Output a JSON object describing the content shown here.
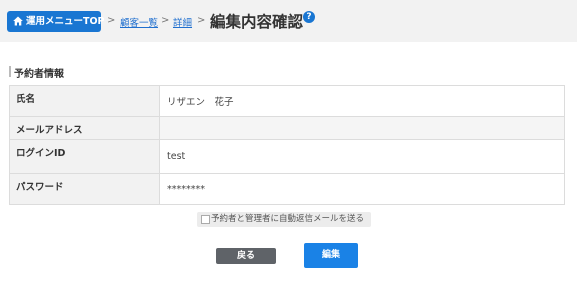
{
  "header": {
    "top_button_label": "運用メニューTOP",
    "breadcrumb": {
      "separator": ">",
      "items": [
        "顧客一覧",
        "詳細"
      ]
    },
    "page_title": "編集内容確認",
    "help_symbol": "?"
  },
  "section": {
    "title": "予約者情報"
  },
  "fields": [
    {
      "label": "氏名",
      "value": "リザエン　花子"
    },
    {
      "label": "メールアドレス",
      "value": ""
    },
    {
      "label": "ログインID",
      "value": "test"
    },
    {
      "label": "パスワード",
      "value": "********"
    }
  ],
  "notify_checkbox": {
    "label": "予約者と管理者に自動返信メールを送る",
    "checked": false
  },
  "buttons": {
    "back": "戻る",
    "edit": "編集"
  },
  "colors": {
    "accent": "#1976d2",
    "back_button": "#5f6368",
    "header_bg": "#f2f2f2"
  },
  "icons": {
    "top_button": "home-icon",
    "help": "help-icon"
  }
}
